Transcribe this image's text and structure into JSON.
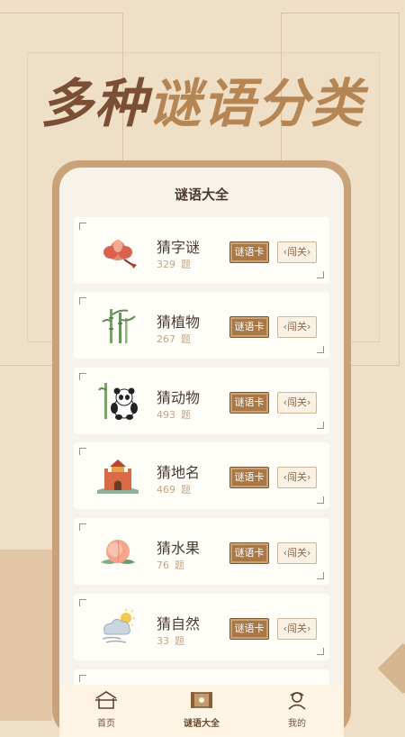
{
  "banner": {
    "part1": "多种",
    "part2": "谜语分类"
  },
  "screen": {
    "title": "谜语大全"
  },
  "categories": [
    {
      "name": "猜字谜",
      "count": "329",
      "unit": "题",
      "card_label": "谜语卡",
      "level_label": "闯关",
      "icon": "lotus-icon"
    },
    {
      "name": "猜植物",
      "count": "267",
      "unit": "题",
      "card_label": "谜语卡",
      "level_label": "闯关",
      "icon": "bamboo-icon"
    },
    {
      "name": "猜动物",
      "count": "493",
      "unit": "题",
      "card_label": "谜语卡",
      "level_label": "闯关",
      "icon": "panda-icon"
    },
    {
      "name": "猜地名",
      "count": "469",
      "unit": "题",
      "card_label": "谜语卡",
      "level_label": "闯关",
      "icon": "great-wall-icon"
    },
    {
      "name": "猜水果",
      "count": "76",
      "unit": "题",
      "card_label": "谜语卡",
      "level_label": "闯关",
      "icon": "peach-icon"
    },
    {
      "name": "猜自然",
      "count": "33",
      "unit": "题",
      "card_label": "谜语卡",
      "level_label": "闯关",
      "icon": "weather-icon"
    }
  ],
  "tabbar": {
    "items": [
      {
        "label": "首页",
        "icon": "home-icon"
      },
      {
        "label": "谜语大全",
        "icon": "scroll-icon",
        "active": true
      },
      {
        "label": "我的",
        "icon": "profile-icon"
      }
    ]
  },
  "colors": {
    "accent": "#a87847",
    "background": "#eedfc6",
    "banner_dark": "#7a4f36",
    "banner_light": "#b58553"
  }
}
